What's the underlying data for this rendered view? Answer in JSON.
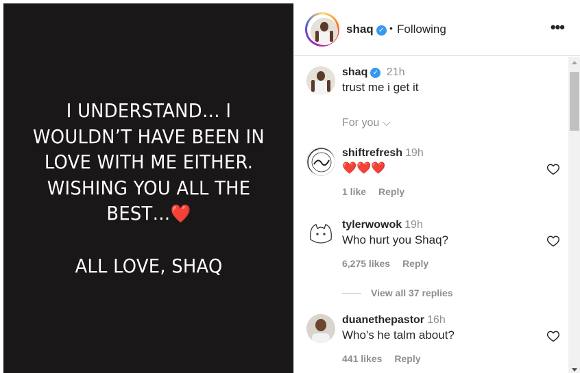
{
  "post": {
    "lines": [
      "I UNDERSTAND… I",
      "WOULDN’T HAVE BEEN IN",
      "LOVE WITH ME EITHER.",
      "WISHING YOU ALL THE",
      "BEST…",
      "ALL LOVE, SHAQ"
    ],
    "heart": "❤️"
  },
  "header": {
    "username": "shaq",
    "verified_icon": "✓",
    "separator": "•",
    "follow_status": "Following",
    "more_icon": "•••"
  },
  "caption": {
    "username": "shaq",
    "time": "21h",
    "text": "trust me i get it"
  },
  "for_you": {
    "label": "For you",
    "chevron": "⌵"
  },
  "comments": [
    {
      "username": "shiftrefresh",
      "time": "19h",
      "text": "❤️❤️❤️",
      "likes": "1 like",
      "reply": "Reply"
    },
    {
      "username": "tylerwowok",
      "time": "19h",
      "text": "Who hurt you Shaq?",
      "likes": "6,275 likes",
      "reply": "Reply"
    },
    {
      "username": "duanethepastor",
      "time": "16h",
      "text": "Who's he talm about?",
      "likes": "441 likes",
      "reply": "Reply"
    }
  ],
  "view_replies": "View all 37 replies",
  "colors": {
    "verified": "#3897f0",
    "heart": "#e8202b",
    "muted": "#8e8e8e",
    "media_bg": "#1a1718"
  }
}
